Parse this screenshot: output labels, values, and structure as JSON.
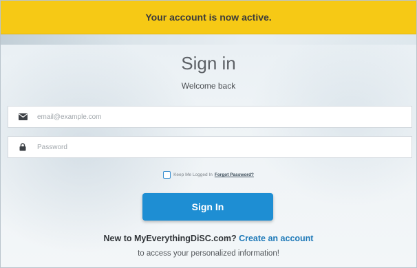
{
  "banner": {
    "message": "Your account is now active.",
    "color": "#f6c915"
  },
  "header": {
    "title": "Sign in",
    "subtitle": "Welcome back"
  },
  "form": {
    "email": {
      "placeholder": "email@example.com",
      "value": "",
      "icon": "envelope-icon"
    },
    "password": {
      "placeholder": "Password",
      "value": "",
      "icon": "lock-icon"
    },
    "keep_logged_in": {
      "label": "Keep Me Logged In",
      "checked": false
    },
    "forgot_password_label": "Forgot Password?",
    "submit_label": "Sign In",
    "submit_color": "#1e8ed3"
  },
  "footer": {
    "new_to_text": "New to MyEverythingDiSC.com?",
    "create_account_label": "Create an account",
    "access_text": "to access your personalized information!",
    "link_color": "#1e79b8"
  }
}
